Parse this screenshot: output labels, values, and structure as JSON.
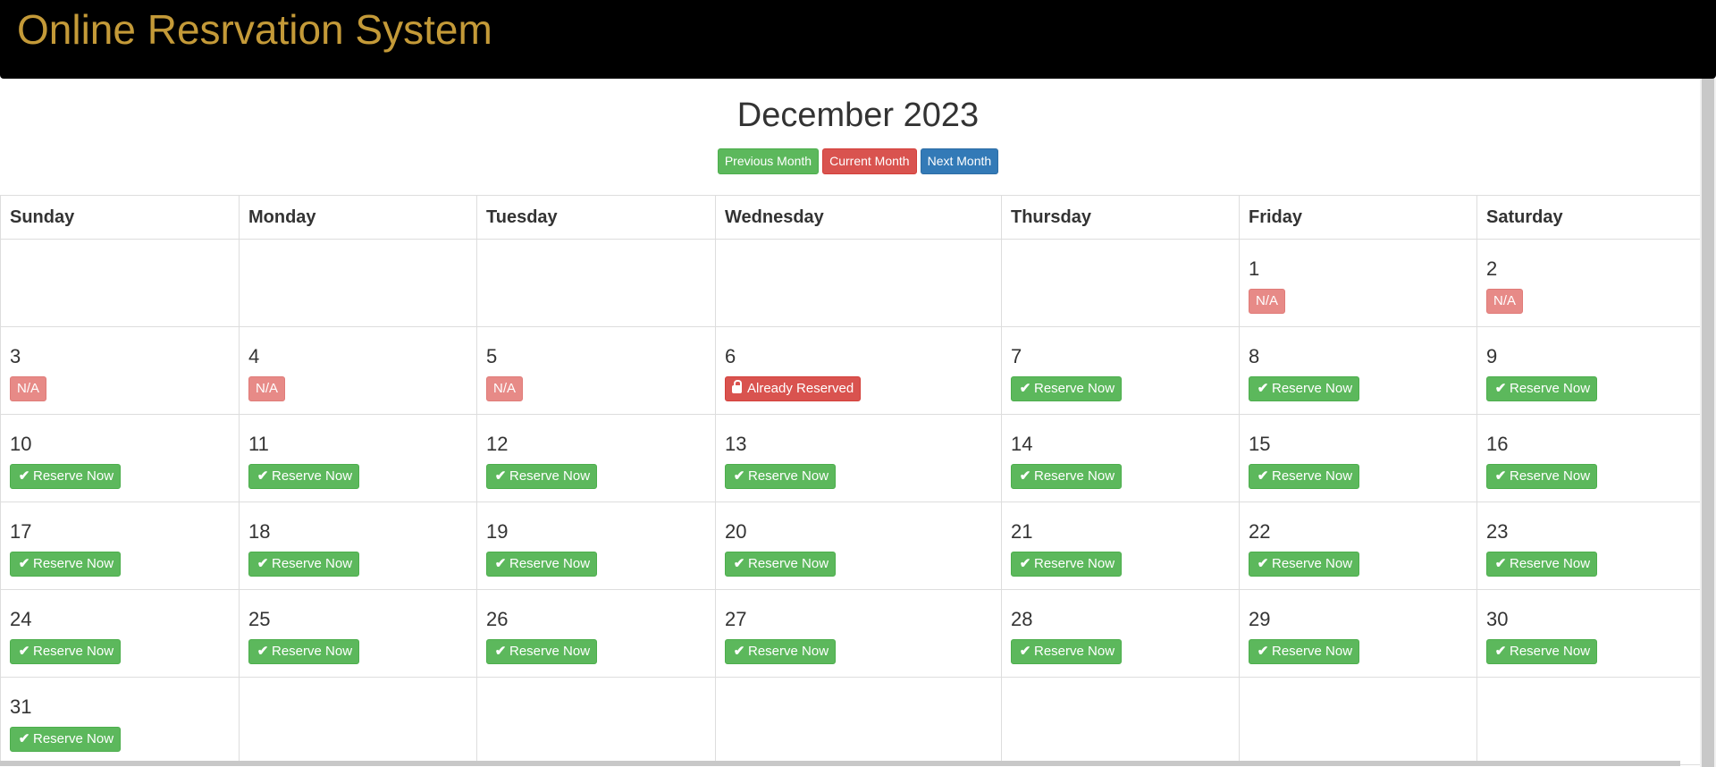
{
  "app": {
    "title": "Online Resrvation System"
  },
  "calendar": {
    "month_title": "December 2023",
    "nav": {
      "prev": "Previous Month",
      "current": "Current Month",
      "next": "Next Month"
    },
    "weekdays": [
      "Sunday",
      "Monday",
      "Tuesday",
      "Wednesday",
      "Thursday",
      "Friday",
      "Saturday"
    ],
    "labels": {
      "na": "N/A",
      "reserve": "Reserve Now",
      "reserved": "Already Reserved"
    },
    "weeks": [
      [
        null,
        null,
        null,
        null,
        null,
        {
          "day": "1",
          "status": "na"
        },
        {
          "day": "2",
          "status": "na"
        }
      ],
      [
        {
          "day": "3",
          "status": "na"
        },
        {
          "day": "4",
          "status": "na"
        },
        {
          "day": "5",
          "status": "na"
        },
        {
          "day": "6",
          "status": "reserved"
        },
        {
          "day": "7",
          "status": "reserve"
        },
        {
          "day": "8",
          "status": "reserve"
        },
        {
          "day": "9",
          "status": "reserve"
        }
      ],
      [
        {
          "day": "10",
          "status": "reserve"
        },
        {
          "day": "11",
          "status": "reserve"
        },
        {
          "day": "12",
          "status": "reserve"
        },
        {
          "day": "13",
          "status": "reserve"
        },
        {
          "day": "14",
          "status": "reserve"
        },
        {
          "day": "15",
          "status": "reserve"
        },
        {
          "day": "16",
          "status": "reserve"
        }
      ],
      [
        {
          "day": "17",
          "status": "reserve"
        },
        {
          "day": "18",
          "status": "reserve"
        },
        {
          "day": "19",
          "status": "reserve"
        },
        {
          "day": "20",
          "status": "reserve"
        },
        {
          "day": "21",
          "status": "reserve"
        },
        {
          "day": "22",
          "status": "reserve"
        },
        {
          "day": "23",
          "status": "reserve"
        }
      ],
      [
        {
          "day": "24",
          "status": "reserve"
        },
        {
          "day": "25",
          "status": "reserve"
        },
        {
          "day": "26",
          "status": "reserve"
        },
        {
          "day": "27",
          "status": "reserve"
        },
        {
          "day": "28",
          "status": "reserve"
        },
        {
          "day": "29",
          "status": "reserve"
        },
        {
          "day": "30",
          "status": "reserve"
        }
      ],
      [
        {
          "day": "31",
          "status": "reserve"
        },
        null,
        null,
        null,
        null,
        null,
        null
      ]
    ]
  },
  "colors": {
    "brand": "#c49a38",
    "success": "#5cb85c",
    "danger": "#d9534f",
    "primary": "#337ab7",
    "na": "#e78a87"
  }
}
